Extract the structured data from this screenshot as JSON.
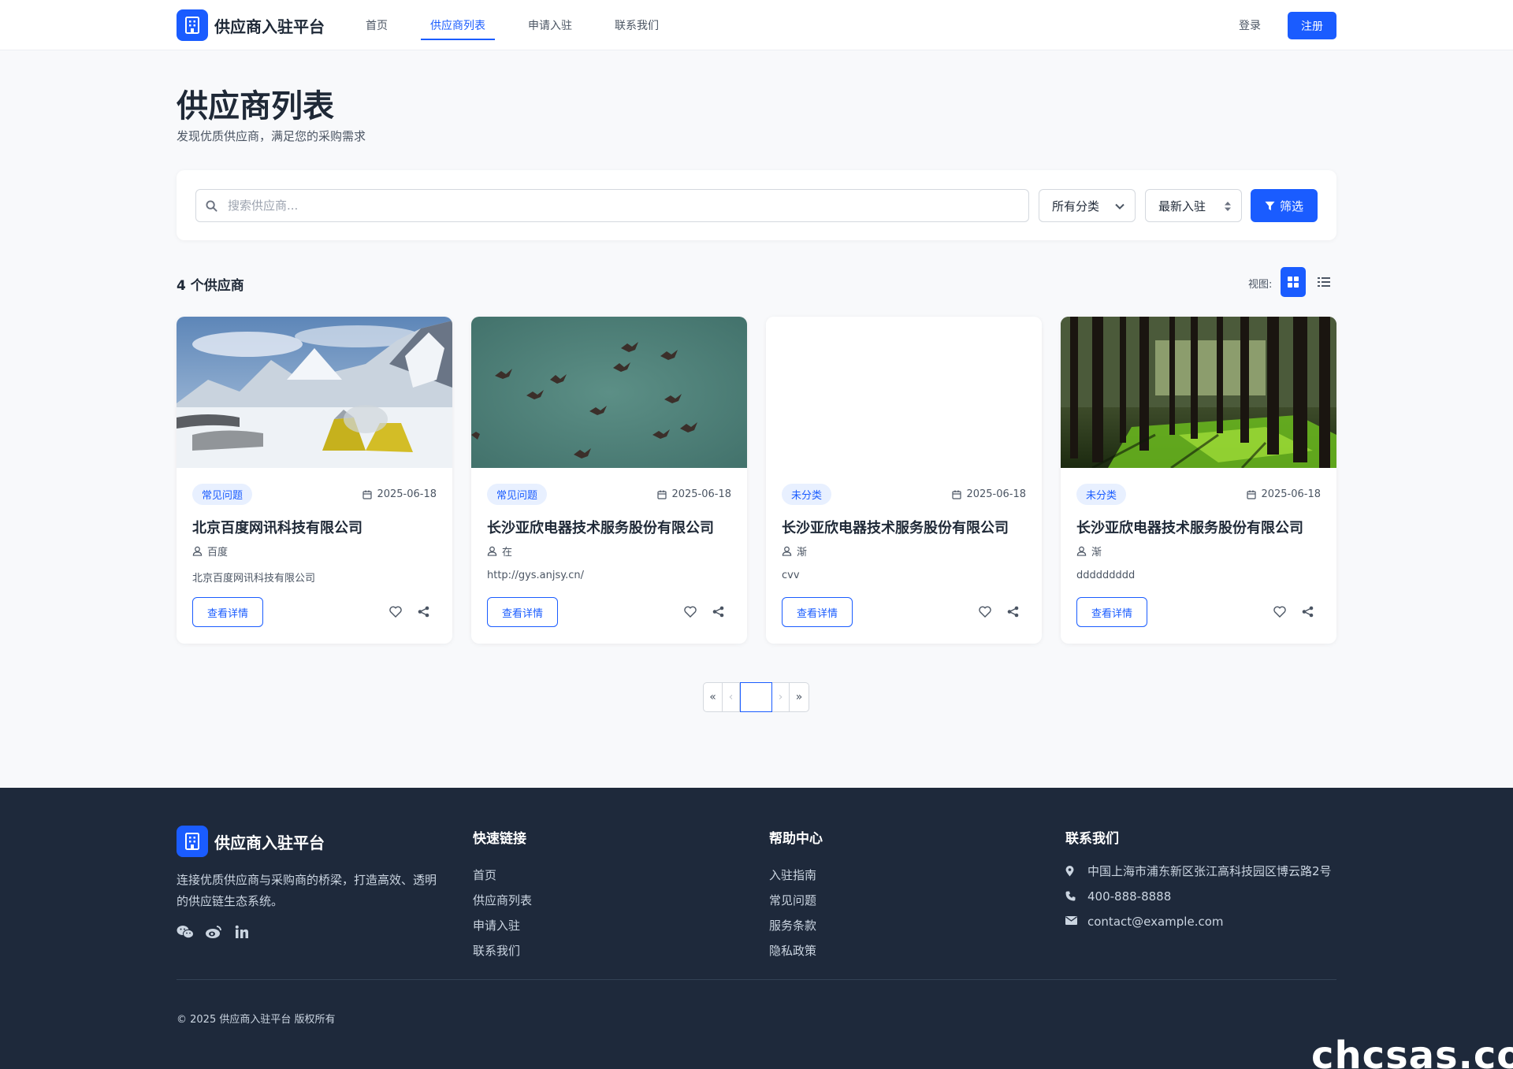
{
  "header": {
    "brand": "供应商入驻平台",
    "nav": [
      {
        "label": "首页",
        "active": false
      },
      {
        "label": "供应商列表",
        "active": true
      },
      {
        "label": "申请入驻",
        "active": false
      },
      {
        "label": "联系我们",
        "active": false
      }
    ],
    "login_label": "登录",
    "register_label": "注册"
  },
  "page": {
    "title": "供应商列表",
    "subtitle": "发现优质供应商，满足您的采购需求"
  },
  "filters": {
    "search_placeholder": "搜索供应商...",
    "search_value": "",
    "category_selected": "所有分类",
    "sort_selected": "最新入驻",
    "filter_button": "筛选"
  },
  "results": {
    "count_text": "4 个供应商",
    "view_label": "视图:",
    "view_mode": "grid"
  },
  "cards": [
    {
      "tag": "常见问题",
      "date": "2025-06-18",
      "title": "北京百度网讯科技有限公司",
      "contact": "百度",
      "desc": "北京百度网讯科技有限公司",
      "detail_label": "查看详情",
      "image": "snow-mountain-camp"
    },
    {
      "tag": "常见问题",
      "date": "2025-06-18",
      "title": "长沙亚欣电器技术服务股份有限公司",
      "contact": "在",
      "desc": "http://gys.anjsy.cn/",
      "detail_label": "查看详情",
      "image": "birds-sky"
    },
    {
      "tag": "未分类",
      "date": "2025-06-18",
      "title": "长沙亚欣电器技术服务股份有限公司",
      "contact": "渐",
      "desc": "cvv",
      "detail_label": "查看详情",
      "image": "blank"
    },
    {
      "tag": "未分类",
      "date": "2025-06-18",
      "title": "长沙亚欣电器技术服务股份有限公司",
      "contact": "渐",
      "desc": "ddddddddd",
      "detail_label": "查看详情",
      "image": "forest"
    }
  ],
  "pagination": {
    "first": "«",
    "prev": "‹",
    "current": "",
    "next": "›",
    "last": "»"
  },
  "footer": {
    "brand": "供应商入驻平台",
    "description": "连接优质供应商与采购商的桥梁，打造高效、透明的供应链生态系统。",
    "social": [
      "wechat-icon",
      "weibo-icon",
      "linkedin-icon"
    ],
    "quick_links_title": "快速链接",
    "quick_links": [
      "首页",
      "供应商列表",
      "申请入驻",
      "联系我们"
    ],
    "help_title": "帮助中心",
    "help_links": [
      "入驻指南",
      "常见问题",
      "服务条款",
      "隐私政策"
    ],
    "contact_title": "联系我们",
    "address": "中国上海市浦东新区张江高科技园区博云路2号",
    "phone": "400-888-8888",
    "email": "contact@example.com",
    "copyright": "© 2025 供应商入驻平台 版权所有"
  },
  "watermark": "chcsas.com",
  "colors": {
    "primary": "#1a5cff",
    "footer_bg": "#1e293b",
    "tag_bg": "#e8f0ff"
  }
}
